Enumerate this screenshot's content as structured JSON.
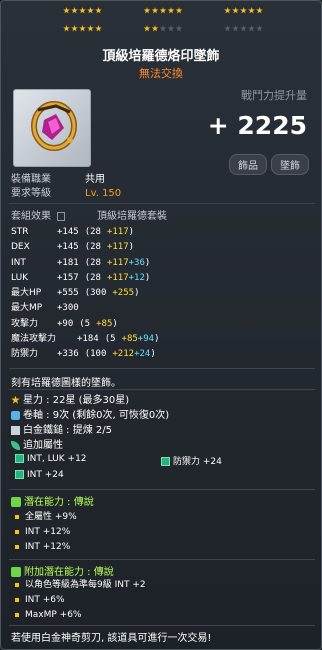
{
  "stars": {
    "row1_filled": 15,
    "row1_total": 15,
    "row2_filled": 7,
    "row2_total": 15
  },
  "item": {
    "name": "頂級培羅德烙印墜飾",
    "trade": "無法交換",
    "power_label": "戰鬥力提升量",
    "power_value": "+ 2225",
    "tags": [
      "飾品",
      "墜飾"
    ]
  },
  "info": {
    "job_label": "裝備職業",
    "job_value": "共用",
    "req_label": "要求等級",
    "req_value": "Lv. 150"
  },
  "set": {
    "label": "套組效果",
    "name": "頂級培羅德套裝"
  },
  "stats": [
    {
      "label": "STR",
      "main": "+145",
      "base": "(28",
      "star": "+117",
      "pot": "",
      "extra": "",
      "close": ")"
    },
    {
      "label": "DEX",
      "main": "+145",
      "base": "(28",
      "star": "+117",
      "pot": "",
      "extra": "",
      "close": ")"
    },
    {
      "label": "INT",
      "main": "+181",
      "base": "(28",
      "star": "+117",
      "pot": "+36",
      "extra": "",
      "close": ")"
    },
    {
      "label": "LUK",
      "main": "+157",
      "base": "(28",
      "star": "+117",
      "pot": "+12",
      "extra": "",
      "close": ")"
    },
    {
      "label": "最大HP",
      "main": "+555",
      "base": "(300",
      "star": "+255",
      "pot": "",
      "extra": "",
      "close": ")"
    },
    {
      "label": "最大MP",
      "main": "+300",
      "base": "",
      "star": "",
      "pot": "",
      "extra": "",
      "close": ""
    },
    {
      "label": "攻擊力",
      "main": "+90",
      "base": "(5",
      "star": "+85",
      "pot": "",
      "extra": "",
      "close": ")"
    },
    {
      "label": "魔法攻擊力",
      "main": "+184",
      "base": "(5",
      "star": "+85",
      "pot": "+94",
      "extra": "",
      "close": ")"
    },
    {
      "label": "防禦力",
      "main": "+336",
      "base": "(100",
      "star": "+212",
      "pot": "+24",
      "extra": "",
      "close": ")"
    }
  ],
  "description": "刻有培羅德圖樣的墜飾。",
  "upgrades": {
    "starforce": "星力 : 22星 (最多30星)",
    "scroll": "卷軸 : 9次 (剩餘0次, 可恢復0次)",
    "hammer": "白金鐵鎚 : 提煉 2/5",
    "extra_label": "追加屬性",
    "extra_rows": [
      {
        "left": "INT, LUK  +12",
        "right": "防禦力  +24"
      },
      {
        "left": "INT  +24",
        "right": ""
      }
    ]
  },
  "potential": {
    "header": "潛在能力 : 傳說",
    "lines": [
      "全屬性 +9%",
      "INT +12%",
      "INT +12%"
    ]
  },
  "bonus_potential": {
    "header": "附加潛在能力 : 傳說",
    "lines": [
      "以角色等級為準每9級 INT +2",
      "INT +6%",
      "MaxMP +6%"
    ]
  },
  "footer": "若使用白金神奇剪刀, 該道具可進行一次交易!"
}
